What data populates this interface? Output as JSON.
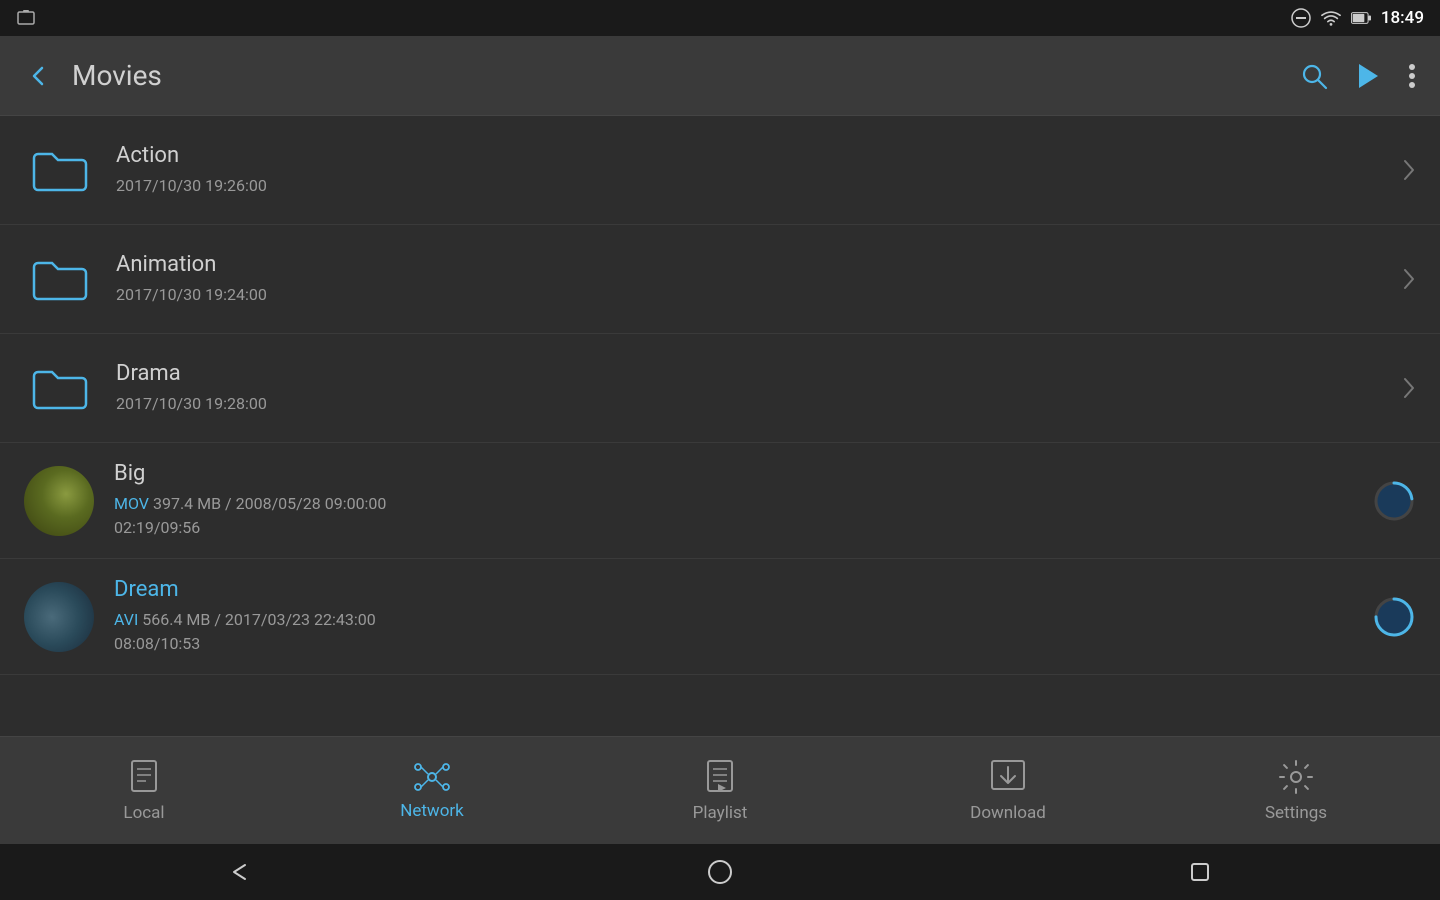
{
  "statusBar": {
    "time": "18:49"
  },
  "header": {
    "back_label": "←",
    "title": "Movies",
    "search_label": "🔍",
    "play_label": "▶",
    "more_label": "⋮"
  },
  "folders": [
    {
      "name": "Action",
      "date": "2017/10/30 19:26:00"
    },
    {
      "name": "Animation",
      "date": "2017/10/30 19:24:00"
    },
    {
      "name": "Drama",
      "date": "2017/10/30 19:28:00"
    }
  ],
  "files": [
    {
      "name": "Big",
      "format": "MOV",
      "size": "397.4 MB",
      "date": "2008/05/28 09:00:00",
      "position": "02:19",
      "duration": "09:56",
      "progress": 23,
      "thumb": "big"
    },
    {
      "name": "Dream",
      "format": "AVI",
      "size": "566.4 MB",
      "date": "2017/03/23 22:43:00",
      "position": "08:08",
      "duration": "10:53",
      "progress": 75,
      "thumb": "dream"
    }
  ],
  "bottomNav": {
    "items": [
      {
        "id": "local",
        "label": "Local",
        "active": false
      },
      {
        "id": "network",
        "label": "Network",
        "active": true
      },
      {
        "id": "playlist",
        "label": "Playlist",
        "active": false
      },
      {
        "id": "download",
        "label": "Download",
        "active": false
      },
      {
        "id": "settings",
        "label": "Settings",
        "active": false
      }
    ]
  },
  "colors": {
    "blue": "#4db6e8",
    "bg": "#2d2d2d",
    "headerBg": "#3a3a3a"
  }
}
